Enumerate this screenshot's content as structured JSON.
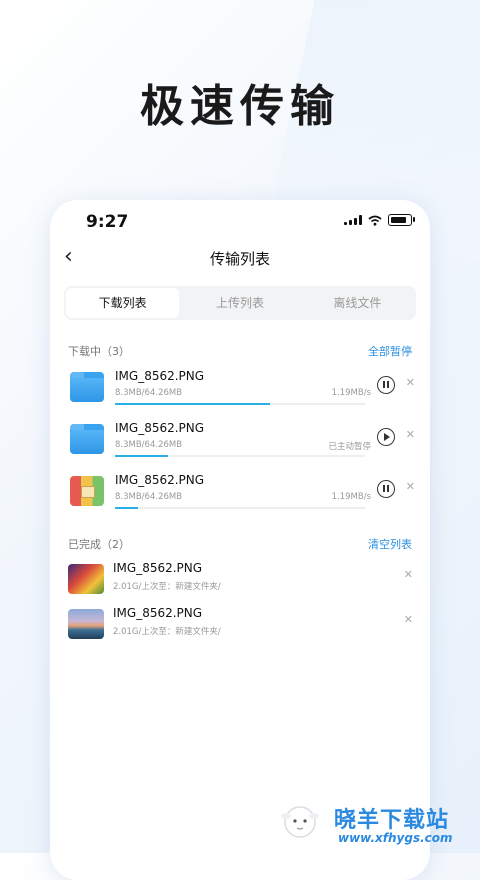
{
  "headline": "极速传输",
  "status_bar": {
    "time": "9:27"
  },
  "nav": {
    "title": "传输列表"
  },
  "tabs": [
    {
      "label": "下载列表",
      "active": true
    },
    {
      "label": "上传列表",
      "active": false
    },
    {
      "label": "离线文件",
      "active": false
    }
  ],
  "downloading": {
    "title": "下载中（3）",
    "action": "全部暂停",
    "items": [
      {
        "name": "IMG_8562.PNG",
        "size": "8.3MB/64.26MB",
        "status": "1.19MB/s",
        "progress": 0.62,
        "icon": "folder-icon",
        "control": "pause"
      },
      {
        "name": "IMG_8562.PNG",
        "size": "8.3MB/64.26MB",
        "status": "已主动暂停",
        "progress": 0.21,
        "icon": "folder-icon",
        "control": "play"
      },
      {
        "name": "IMG_8562.PNG",
        "size": "8.3MB/64.26MB",
        "status": "1.19MB/s",
        "progress": 0.09,
        "icon": "image-grid-icon",
        "control": "pause"
      }
    ]
  },
  "completed": {
    "title": "已完成（2）",
    "action": "清空列表",
    "items": [
      {
        "name": "IMG_8562.PNG",
        "detail": "2.01G/上次至：新建文件夹/",
        "icon": "photo-thumbnail"
      },
      {
        "name": "IMG_8562.PNG",
        "detail": "2.01G/上次至：新建文件夹/",
        "icon": "photo-thumbnail"
      }
    ]
  },
  "watermark": {
    "text": "晓羊下载站",
    "url": "www.xfhygs.com"
  },
  "colors": {
    "accent": "#2a8fe0",
    "progress": "#2ab0e6"
  }
}
